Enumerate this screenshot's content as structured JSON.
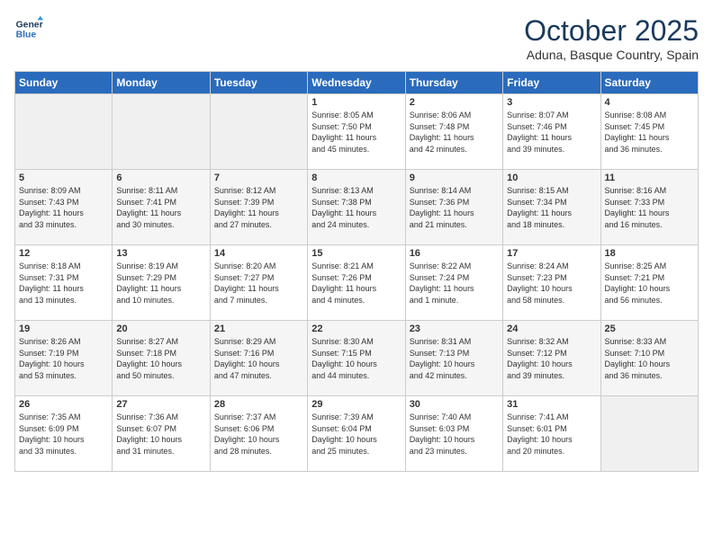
{
  "logo": {
    "line1": "General",
    "line2": "Blue"
  },
  "title": "October 2025",
  "subtitle": "Aduna, Basque Country, Spain",
  "weekdays": [
    "Sunday",
    "Monday",
    "Tuesday",
    "Wednesday",
    "Thursday",
    "Friday",
    "Saturday"
  ],
  "weeks": [
    [
      {
        "day": "",
        "info": ""
      },
      {
        "day": "",
        "info": ""
      },
      {
        "day": "",
        "info": ""
      },
      {
        "day": "1",
        "info": "Sunrise: 8:05 AM\nSunset: 7:50 PM\nDaylight: 11 hours\nand 45 minutes."
      },
      {
        "day": "2",
        "info": "Sunrise: 8:06 AM\nSunset: 7:48 PM\nDaylight: 11 hours\nand 42 minutes."
      },
      {
        "day": "3",
        "info": "Sunrise: 8:07 AM\nSunset: 7:46 PM\nDaylight: 11 hours\nand 39 minutes."
      },
      {
        "day": "4",
        "info": "Sunrise: 8:08 AM\nSunset: 7:45 PM\nDaylight: 11 hours\nand 36 minutes."
      }
    ],
    [
      {
        "day": "5",
        "info": "Sunrise: 8:09 AM\nSunset: 7:43 PM\nDaylight: 11 hours\nand 33 minutes."
      },
      {
        "day": "6",
        "info": "Sunrise: 8:11 AM\nSunset: 7:41 PM\nDaylight: 11 hours\nand 30 minutes."
      },
      {
        "day": "7",
        "info": "Sunrise: 8:12 AM\nSunset: 7:39 PM\nDaylight: 11 hours\nand 27 minutes."
      },
      {
        "day": "8",
        "info": "Sunrise: 8:13 AM\nSunset: 7:38 PM\nDaylight: 11 hours\nand 24 minutes."
      },
      {
        "day": "9",
        "info": "Sunrise: 8:14 AM\nSunset: 7:36 PM\nDaylight: 11 hours\nand 21 minutes."
      },
      {
        "day": "10",
        "info": "Sunrise: 8:15 AM\nSunset: 7:34 PM\nDaylight: 11 hours\nand 18 minutes."
      },
      {
        "day": "11",
        "info": "Sunrise: 8:16 AM\nSunset: 7:33 PM\nDaylight: 11 hours\nand 16 minutes."
      }
    ],
    [
      {
        "day": "12",
        "info": "Sunrise: 8:18 AM\nSunset: 7:31 PM\nDaylight: 11 hours\nand 13 minutes."
      },
      {
        "day": "13",
        "info": "Sunrise: 8:19 AM\nSunset: 7:29 PM\nDaylight: 11 hours\nand 10 minutes."
      },
      {
        "day": "14",
        "info": "Sunrise: 8:20 AM\nSunset: 7:27 PM\nDaylight: 11 hours\nand 7 minutes."
      },
      {
        "day": "15",
        "info": "Sunrise: 8:21 AM\nSunset: 7:26 PM\nDaylight: 11 hours\nand 4 minutes."
      },
      {
        "day": "16",
        "info": "Sunrise: 8:22 AM\nSunset: 7:24 PM\nDaylight: 11 hours\nand 1 minute."
      },
      {
        "day": "17",
        "info": "Sunrise: 8:24 AM\nSunset: 7:23 PM\nDaylight: 10 hours\nand 58 minutes."
      },
      {
        "day": "18",
        "info": "Sunrise: 8:25 AM\nSunset: 7:21 PM\nDaylight: 10 hours\nand 56 minutes."
      }
    ],
    [
      {
        "day": "19",
        "info": "Sunrise: 8:26 AM\nSunset: 7:19 PM\nDaylight: 10 hours\nand 53 minutes."
      },
      {
        "day": "20",
        "info": "Sunrise: 8:27 AM\nSunset: 7:18 PM\nDaylight: 10 hours\nand 50 minutes."
      },
      {
        "day": "21",
        "info": "Sunrise: 8:29 AM\nSunset: 7:16 PM\nDaylight: 10 hours\nand 47 minutes."
      },
      {
        "day": "22",
        "info": "Sunrise: 8:30 AM\nSunset: 7:15 PM\nDaylight: 10 hours\nand 44 minutes."
      },
      {
        "day": "23",
        "info": "Sunrise: 8:31 AM\nSunset: 7:13 PM\nDaylight: 10 hours\nand 42 minutes."
      },
      {
        "day": "24",
        "info": "Sunrise: 8:32 AM\nSunset: 7:12 PM\nDaylight: 10 hours\nand 39 minutes."
      },
      {
        "day": "25",
        "info": "Sunrise: 8:33 AM\nSunset: 7:10 PM\nDaylight: 10 hours\nand 36 minutes."
      }
    ],
    [
      {
        "day": "26",
        "info": "Sunrise: 7:35 AM\nSunset: 6:09 PM\nDaylight: 10 hours\nand 33 minutes."
      },
      {
        "day": "27",
        "info": "Sunrise: 7:36 AM\nSunset: 6:07 PM\nDaylight: 10 hours\nand 31 minutes."
      },
      {
        "day": "28",
        "info": "Sunrise: 7:37 AM\nSunset: 6:06 PM\nDaylight: 10 hours\nand 28 minutes."
      },
      {
        "day": "29",
        "info": "Sunrise: 7:39 AM\nSunset: 6:04 PM\nDaylight: 10 hours\nand 25 minutes."
      },
      {
        "day": "30",
        "info": "Sunrise: 7:40 AM\nSunset: 6:03 PM\nDaylight: 10 hours\nand 23 minutes."
      },
      {
        "day": "31",
        "info": "Sunrise: 7:41 AM\nSunset: 6:01 PM\nDaylight: 10 hours\nand 20 minutes."
      },
      {
        "day": "",
        "info": ""
      }
    ]
  ]
}
